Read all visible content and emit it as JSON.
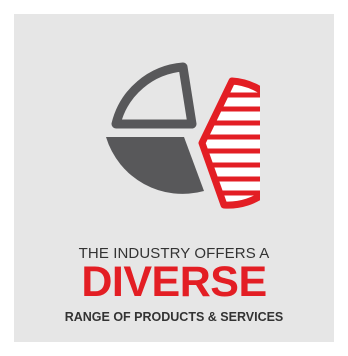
{
  "infographic": {
    "line1": "THE INDUSTRY OFFERS A",
    "line2": "DIVERSE",
    "line3": "RANGE OF PRODUCTS & SERVICES"
  },
  "icon": {
    "name": "pie-chart-icon",
    "colors": {
      "gray": "#58585a",
      "red": "#e31e24",
      "background": "#e6e6e6"
    }
  }
}
